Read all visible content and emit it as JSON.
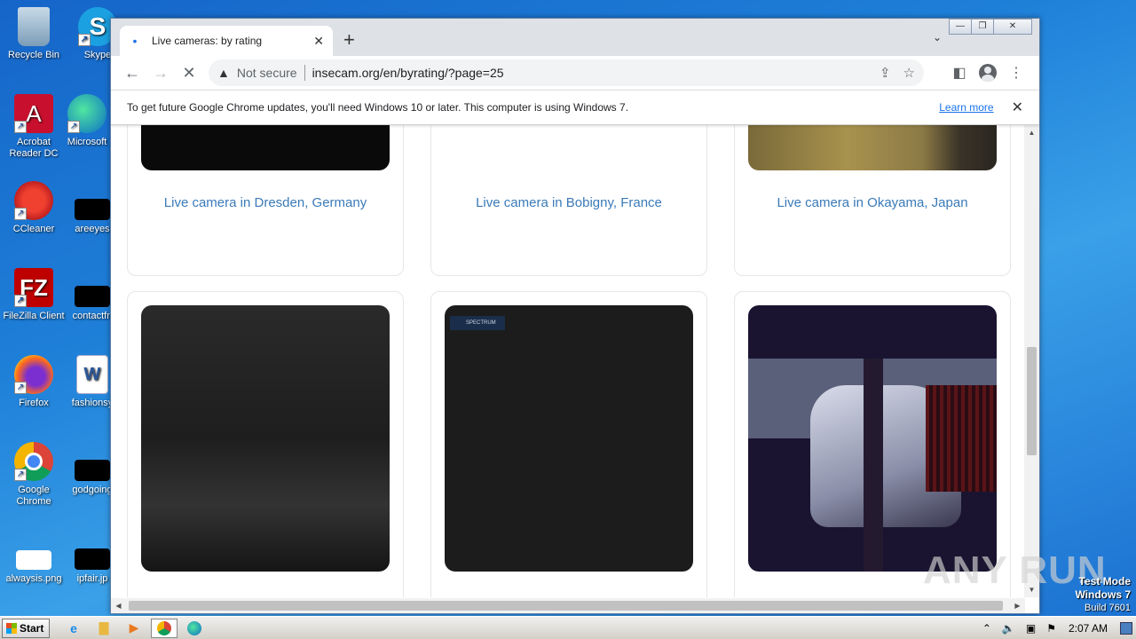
{
  "desktop": {
    "icons": [
      {
        "label": "Recycle Bin"
      },
      {
        "label": "Skype"
      },
      {
        "label": "Acrobat Reader DC"
      },
      {
        "label": "Microsoft"
      },
      {
        "label": "CCleaner"
      },
      {
        "label": "areeyes"
      },
      {
        "label": "FileZilla Client"
      },
      {
        "label": "contactfri"
      },
      {
        "label": "Firefox"
      },
      {
        "label": "fashionsy"
      },
      {
        "label": "Google Chrome"
      },
      {
        "label": "godgoing"
      },
      {
        "label": "alwaysis.png"
      },
      {
        "label": "ipfair.jp"
      }
    ]
  },
  "browser": {
    "tab_title": "Live cameras: by rating",
    "new_tab": "+",
    "window_controls": {
      "minimize": "—",
      "restore": "❐",
      "close": "✕"
    },
    "address": {
      "security_label": "Not secure",
      "url": "insecam.org/en/byrating/?page=25"
    },
    "infobar": {
      "message": "To get future Google Chrome updates, you'll need Windows 10 or later. This computer is using Windows 7.",
      "learn_more": "Learn more"
    }
  },
  "page": {
    "cards": [
      {
        "label": "Live camera in Dresden, Germany"
      },
      {
        "label": "Live camera in Bobigny, France"
      },
      {
        "label": "Live camera in Okayama, Japan"
      },
      {
        "label": ""
      },
      {
        "label": ""
      },
      {
        "label": ""
      }
    ],
    "overlay_text": "SPECTRUM"
  },
  "watermark": "ANY RUN",
  "test_mode": {
    "line1": "Test Mode",
    "line2": "Windows 7",
    "line3": "Build 7601"
  },
  "taskbar": {
    "start_label": "Start",
    "clock": "2:07 AM"
  }
}
